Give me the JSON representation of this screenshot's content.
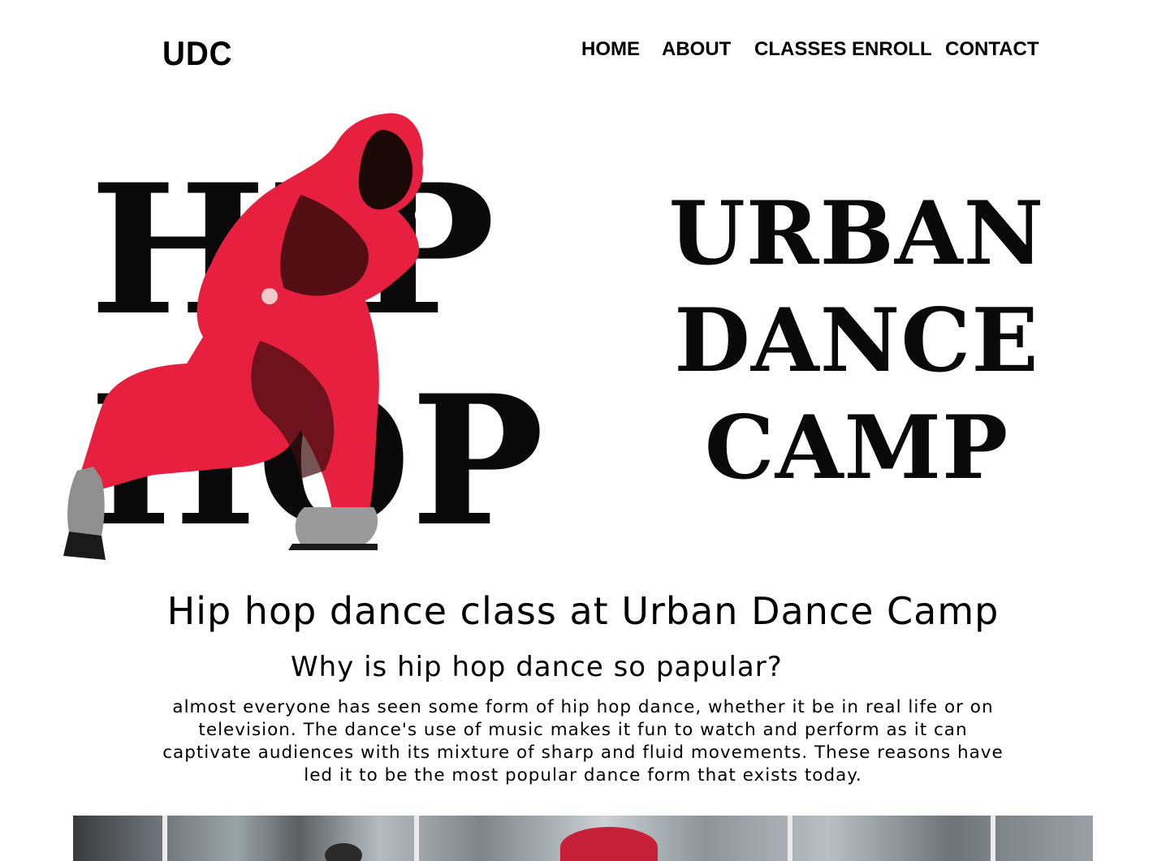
{
  "header": {
    "logo": "UDC",
    "nav": [
      {
        "label": "HOME"
      },
      {
        "label": "ABOUT"
      },
      {
        "label": "CLASSES ENROLL"
      },
      {
        "label": "CONTACT"
      }
    ]
  },
  "hero": {
    "art_words": [
      "HIP",
      "HOP"
    ],
    "title_lines": [
      "URBAN",
      "DANCE",
      "CAMP"
    ]
  },
  "content": {
    "heading": "Hip hop dance class at Urban Dance Camp",
    "subheading": "Why is hip hop dance so papular?",
    "paragraph": "almost everyone has seen some form of hip hop dance, whether it be in real life or on television. The dance's use of music makes it fun to watch and perform as it can captivate audiences with its mixture of sharp and fluid movements. These reasons have led it to be the most popular dance form that exists today."
  },
  "colors": {
    "hoodie": "#e8203f",
    "hoodie_shadow": "#1c0a08",
    "ink": "#0a0a0a"
  }
}
